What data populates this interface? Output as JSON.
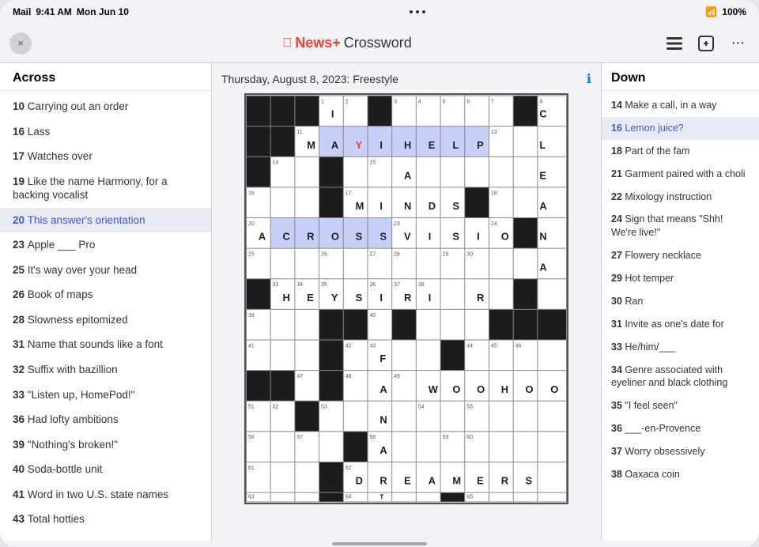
{
  "statusBar": {
    "app": "Mail",
    "time": "9:41 AM",
    "date": "Mon Jun 10",
    "dots": [
      "•",
      "•",
      "•"
    ],
    "wifi": "WiFi",
    "battery": "100%"
  },
  "toolbar": {
    "closeLabel": "×",
    "logoPrefix": "News+",
    "logoSuffix": " Crossword",
    "listIconLabel": "☰",
    "shareIconLabel": "⊡",
    "moreIconLabel": "•••"
  },
  "gridHeader": {
    "title": "Thursday, August 8, 2023: Freestyle",
    "infoIcon": "ℹ"
  },
  "acrossPanel": {
    "header": "Across",
    "clues": [
      {
        "number": "10",
        "text": "Carrying out an order"
      },
      {
        "number": "16",
        "text": "Lass"
      },
      {
        "number": "17",
        "text": "Watches over"
      },
      {
        "number": "19",
        "text": "Like the name Harmony, for a backing vocalist"
      },
      {
        "number": "20",
        "text": "This answer's orientation",
        "active": true
      },
      {
        "number": "23",
        "text": "Apple ___ Pro"
      },
      {
        "number": "25",
        "text": "It's way over your head"
      },
      {
        "number": "26",
        "text": "Book of maps"
      },
      {
        "number": "28",
        "text": "Slowness epitomized"
      },
      {
        "number": "31",
        "text": "Name that sounds like a font"
      },
      {
        "number": "32",
        "text": "Suffix with bazillion"
      },
      {
        "number": "33",
        "text": "\"Listen up, HomePod!\""
      },
      {
        "number": "36",
        "text": "Had lofty ambitions"
      },
      {
        "number": "39",
        "text": "\"Nothing's broken!\""
      },
      {
        "number": "40",
        "text": "Soda-bottle unit"
      },
      {
        "number": "41",
        "text": "Word in two U.S. state names"
      },
      {
        "number": "43",
        "text": "Total hotties"
      }
    ]
  },
  "downPanel": {
    "header": "Down",
    "clues": [
      {
        "number": "14",
        "text": "Make a call, in a way"
      },
      {
        "number": "16",
        "text": "Lemon juice?",
        "active": true
      },
      {
        "number": "18",
        "text": "Part of the fam"
      },
      {
        "number": "21",
        "text": "Garment paired with a choli"
      },
      {
        "number": "22",
        "text": "Mixology instruction"
      },
      {
        "number": "24",
        "text": "Sign that means \"Shh! We're live!\""
      },
      {
        "number": "27",
        "text": "Flowery necklace"
      },
      {
        "number": "29",
        "text": "Hot temper"
      },
      {
        "number": "30",
        "text": "Ran"
      },
      {
        "number": "31",
        "text": "Invite as one's date for"
      },
      {
        "number": "33",
        "text": "He/him/___"
      },
      {
        "number": "34",
        "text": "Genre associated with eyeliner and black clothing"
      },
      {
        "number": "35",
        "text": "\"I feel seen\""
      },
      {
        "number": "36",
        "text": "___-en-Provence"
      },
      {
        "number": "37",
        "text": "Worry obsessively"
      },
      {
        "number": "38",
        "text": "Oaxaca coin"
      }
    ]
  },
  "grid": {
    "rows": 13,
    "cols": 13,
    "cells": [
      [
        {
          "black": true
        },
        {
          "black": true
        },
        {
          "black": true
        },
        {
          "black": true
        },
        {
          "black": true
        },
        {
          "black": true
        },
        {
          "black": true
        },
        {
          "black": true
        },
        {
          "black": true
        },
        {
          "black": true
        },
        {
          "black": true
        },
        {
          "black": true
        },
        {
          "black": true
        }
      ],
      [
        {
          "black": true
        },
        {
          "black": true
        },
        {
          "black": true
        },
        {
          "black": true
        },
        {
          "black": true
        },
        {
          "black": true
        },
        {
          "black": true
        },
        {
          "black": true
        },
        {
          "black": true
        },
        {
          "black": true
        },
        {
          "black": true
        },
        {
          "black": true
        },
        {
          "black": true
        }
      ],
      [
        {
          "black": true
        },
        {
          "black": true
        },
        {
          "black": true
        },
        {
          "black": true
        },
        {
          "black": true
        },
        {
          "black": true
        },
        {
          "black": true
        },
        {
          "black": true
        },
        {
          "black": true
        },
        {
          "black": true
        },
        {
          "black": true
        },
        {
          "black": true
        },
        {
          "black": true
        }
      ],
      [
        {
          "black": true
        },
        {
          "black": true
        },
        {
          "black": true
        },
        {
          "black": true
        },
        {
          "black": true
        },
        {
          "black": true
        },
        {
          "black": true
        },
        {
          "black": true
        },
        {
          "black": true
        },
        {
          "black": true
        },
        {
          "black": true
        },
        {
          "black": true
        },
        {
          "black": true
        }
      ],
      [
        {
          "black": true
        },
        {
          "black": true
        },
        {
          "black": true
        },
        {
          "black": true
        },
        {
          "black": true
        },
        {
          "black": true
        },
        {
          "black": true
        },
        {
          "black": true
        },
        {
          "black": true
        },
        {
          "black": true
        },
        {
          "black": true
        },
        {
          "black": true
        },
        {
          "black": true
        }
      ],
      [
        {
          "black": true
        },
        {
          "black": true
        },
        {
          "black": true
        },
        {
          "black": true
        },
        {
          "black": true
        },
        {
          "black": true
        },
        {
          "black": true
        },
        {
          "black": true
        },
        {
          "black": true
        },
        {
          "black": true
        },
        {
          "black": true
        },
        {
          "black": true
        },
        {
          "black": true
        }
      ],
      [
        {
          "black": true
        },
        {
          "black": true
        },
        {
          "black": true
        },
        {
          "black": true
        },
        {
          "black": true
        },
        {
          "black": true
        },
        {
          "black": true
        },
        {
          "black": true
        },
        {
          "black": true
        },
        {
          "black": true
        },
        {
          "black": true
        },
        {
          "black": true
        },
        {
          "black": true
        }
      ],
      [
        {
          "black": true
        },
        {
          "black": true
        },
        {
          "black": true
        },
        {
          "black": true
        },
        {
          "black": true
        },
        {
          "black": true
        },
        {
          "black": true
        },
        {
          "black": true
        },
        {
          "black": true
        },
        {
          "black": true
        },
        {
          "black": true
        },
        {
          "black": true
        },
        {
          "black": true
        }
      ],
      [
        {
          "black": true
        },
        {
          "black": true
        },
        {
          "black": true
        },
        {
          "black": true
        },
        {
          "black": true
        },
        {
          "black": true
        },
        {
          "black": true
        },
        {
          "black": true
        },
        {
          "black": true
        },
        {
          "black": true
        },
        {
          "black": true
        },
        {
          "black": true
        },
        {
          "black": true
        }
      ],
      [
        {
          "black": true
        },
        {
          "black": true
        },
        {
          "black": true
        },
        {
          "black": true
        },
        {
          "black": true
        },
        {
          "black": true
        },
        {
          "black": true
        },
        {
          "black": true
        },
        {
          "black": true
        },
        {
          "black": true
        },
        {
          "black": true
        },
        {
          "black": true
        },
        {
          "black": true
        }
      ],
      [
        {
          "black": true
        },
        {
          "black": true
        },
        {
          "black": true
        },
        {
          "black": true
        },
        {
          "black": true
        },
        {
          "black": true
        },
        {
          "black": true
        },
        {
          "black": true
        },
        {
          "black": true
        },
        {
          "black": true
        },
        {
          "black": true
        },
        {
          "black": true
        },
        {
          "black": true
        }
      ],
      [
        {
          "black": true
        },
        {
          "black": true
        },
        {
          "black": true
        },
        {
          "black": true
        },
        {
          "black": true
        },
        {
          "black": true
        },
        {
          "black": true
        },
        {
          "black": true
        },
        {
          "black": true
        },
        {
          "black": true
        },
        {
          "black": true
        },
        {
          "black": true
        },
        {
          "black": true
        }
      ],
      [
        {
          "black": true
        },
        {
          "black": true
        },
        {
          "black": true
        },
        {
          "black": true
        },
        {
          "black": true
        },
        {
          "black": true
        },
        {
          "black": true
        },
        {
          "black": true
        },
        {
          "black": true
        },
        {
          "black": true
        },
        {
          "black": true
        },
        {
          "black": true
        },
        {
          "black": true
        }
      ]
    ]
  }
}
